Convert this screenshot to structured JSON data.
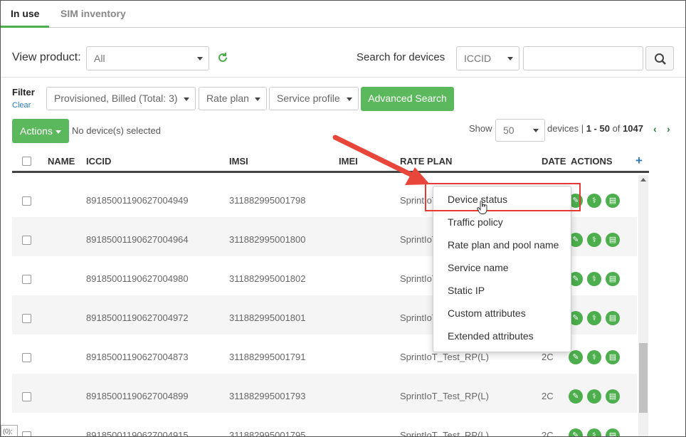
{
  "tabs": [
    {
      "label": "In use",
      "active": true
    },
    {
      "label": "SIM inventory",
      "active": false
    }
  ],
  "toolbar": {
    "view_product_label": "View product:",
    "view_product_value": "All",
    "search_label": "Search for devices",
    "search_field_value": "ICCID",
    "search_input_value": ""
  },
  "filter": {
    "title": "Filter",
    "clear": "Clear",
    "status": "Provisioned, Billed (Total: 3)",
    "rate_plan": "Rate plan",
    "service_profile": "Service profile",
    "advanced_search": "Advanced Search"
  },
  "actions": {
    "label": "Actions",
    "selection_text": "No device(s) selected"
  },
  "paging": {
    "show_label": "Show",
    "page_size": "50",
    "devices_label": "devices |",
    "range": "1 - 50",
    "of_label": "of",
    "total": "1047"
  },
  "table": {
    "columns": [
      "NAME",
      "ICCID",
      "IMSI",
      "IMEI",
      "RATE PLAN",
      "DATE",
      "ACTIONS"
    ],
    "rows": [
      {
        "name": "",
        "iccid": "89185001190627004949",
        "imsi": "311882995001798",
        "imei": "",
        "rate_plan": "SprintIoT",
        "date": ""
      },
      {
        "name": "",
        "iccid": "89185001190627004964",
        "imsi": "311882995001800",
        "imei": "",
        "rate_plan": "SprintIoT",
        "date": ""
      },
      {
        "name": "",
        "iccid": "89185001190627004980",
        "imsi": "311882995001802",
        "imei": "",
        "rate_plan": "SprintIoT",
        "date": ""
      },
      {
        "name": "",
        "iccid": "89185001190627004972",
        "imsi": "311882995001801",
        "imei": "",
        "rate_plan": "SprintIoT",
        "date": ""
      },
      {
        "name": "",
        "iccid": "89185001190627004873",
        "imsi": "311882995001791",
        "imei": "",
        "rate_plan": "SprintIoT_Test_RP(L)",
        "date": "2C"
      },
      {
        "name": "",
        "iccid": "89185001190627004899",
        "imsi": "311882995001793",
        "imei": "",
        "rate_plan": "SprintIoT_Test_RP(L)",
        "date": "2C"
      },
      {
        "name": "",
        "iccid": "89185001190627004915",
        "imsi": "311882995001795",
        "imei": "",
        "rate_plan": "SprintIoT_Test_RP(L)",
        "date": "2C"
      }
    ]
  },
  "menu": {
    "items": [
      "Device status",
      "Traffic policy",
      "Rate plan and pool name",
      "Service name",
      "Static IP",
      "Custom attributes",
      "Extended attributes"
    ]
  },
  "bottom_left_text": "(0);",
  "colors": {
    "accent_green": "#5cb85c",
    "highlight_red": "#e53935",
    "link_blue": "#2a7ab8"
  }
}
